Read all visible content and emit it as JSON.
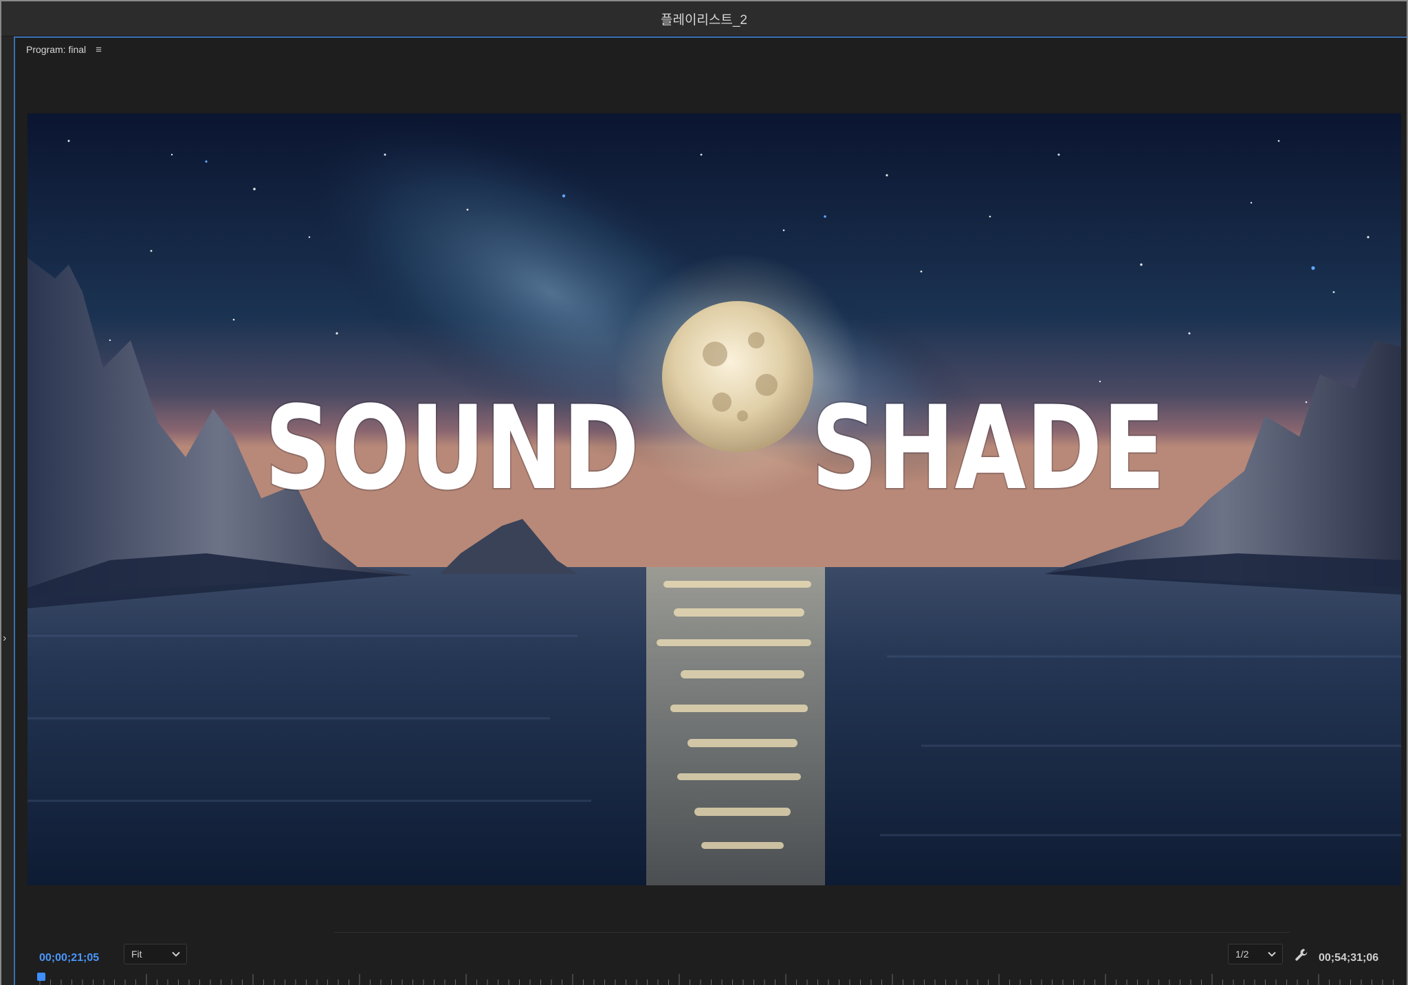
{
  "window": {
    "title": "플레이리스트_2"
  },
  "panel": {
    "title": "Program: final",
    "menu_icon": "hamburger-menu-icon"
  },
  "video": {
    "overlay_words": [
      "SOUND",
      "SHADE"
    ]
  },
  "controls": {
    "current_timecode": "00;00;21;05",
    "zoom_label": "Fit",
    "resolution_label": "1/2",
    "duration_timecode": "00;54;31;06",
    "settings_icon": "wrench-icon"
  },
  "colors": {
    "accent": "#3e8fff",
    "timecode_current": "#4a97ff",
    "panel_bg": "#1e1e1e",
    "titlebar_bg": "#2c2c2c"
  }
}
